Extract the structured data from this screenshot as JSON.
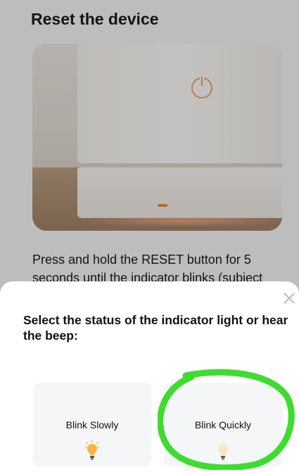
{
  "page": {
    "title": "Reset the device",
    "instruction": "Press and hold the RESET button for 5 seconds until the indicator blinks (subject"
  },
  "sheet": {
    "title": "Select the status of the indicator light or hear the beep:",
    "options": [
      {
        "label": "Blink Slowly",
        "icon": "bulb-blinking-icon"
      },
      {
        "label": "Blink Quickly",
        "icon": "bulb-dim-icon"
      }
    ]
  },
  "colors": {
    "bulb_on": "#f6b73c",
    "bulb_dim": "#f7e7c4",
    "highlight": "#3ddc2e",
    "led": "#f08a2a"
  }
}
